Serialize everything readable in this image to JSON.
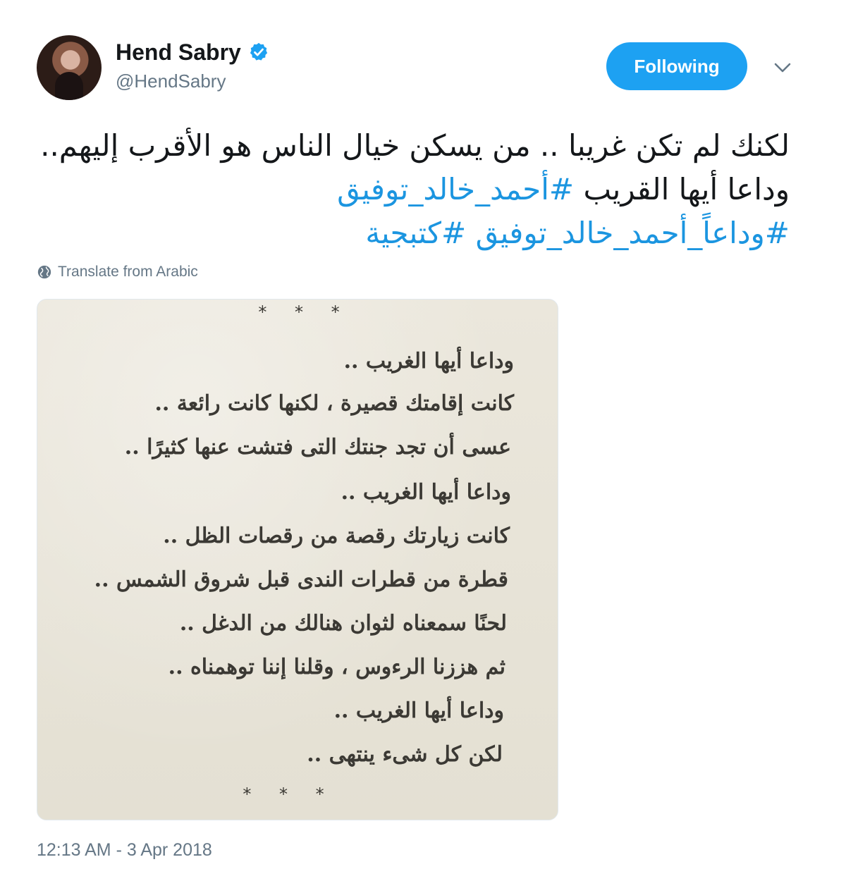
{
  "tweet": {
    "display_name": "Hend Sabry",
    "handle": "@HendSabry",
    "follow_label": "Following",
    "text_part1": "لكنك لم تكن غريبا .. من يسكن خيال الناس هو الأقرب إليهم.. وداعا أيها القريب ",
    "hashtag1": "#أحمد_خالد_توفيق",
    "hashtag2": "#وداعاً_أحمد_خالد_توفيق",
    "hashtag3": "#كتبجية",
    "translate_label": "Translate from Arabic",
    "timestamp": "12:13 AM - 3 Apr 2018"
  },
  "image": {
    "stars_top": "* * *",
    "stars_bottom": "* * *",
    "lines": [
      "وداعا أيها الغريب ..",
      "كانت إقامتك قصيرة ، لكنها كانت رائعة ..",
      "عسى أن تجد جنتك التى فتشت عنها كثيرًا ..",
      "وداعا أيها الغريب ..",
      "كانت زيارتك رقصة من رقصات الظل ..",
      "قطرة من قطرات الندى قبل شروق الشمس ..",
      "لحنًا سمعناه لثوان هنالك من الدغل ..",
      "ثم هززنا الرءوس ، وقلنا إننا توهمناه ..",
      "وداعا أيها الغريب ..",
      "لكن كل شىء ينتهى .."
    ]
  },
  "colors": {
    "accent": "#1da1f2",
    "link": "#1b95e0",
    "secondary_text": "#657786",
    "paper": "#e7e3d7"
  },
  "icons": {
    "verified": "verified-badge-icon",
    "caret": "chevron-down-icon",
    "globe": "globe-icon"
  }
}
